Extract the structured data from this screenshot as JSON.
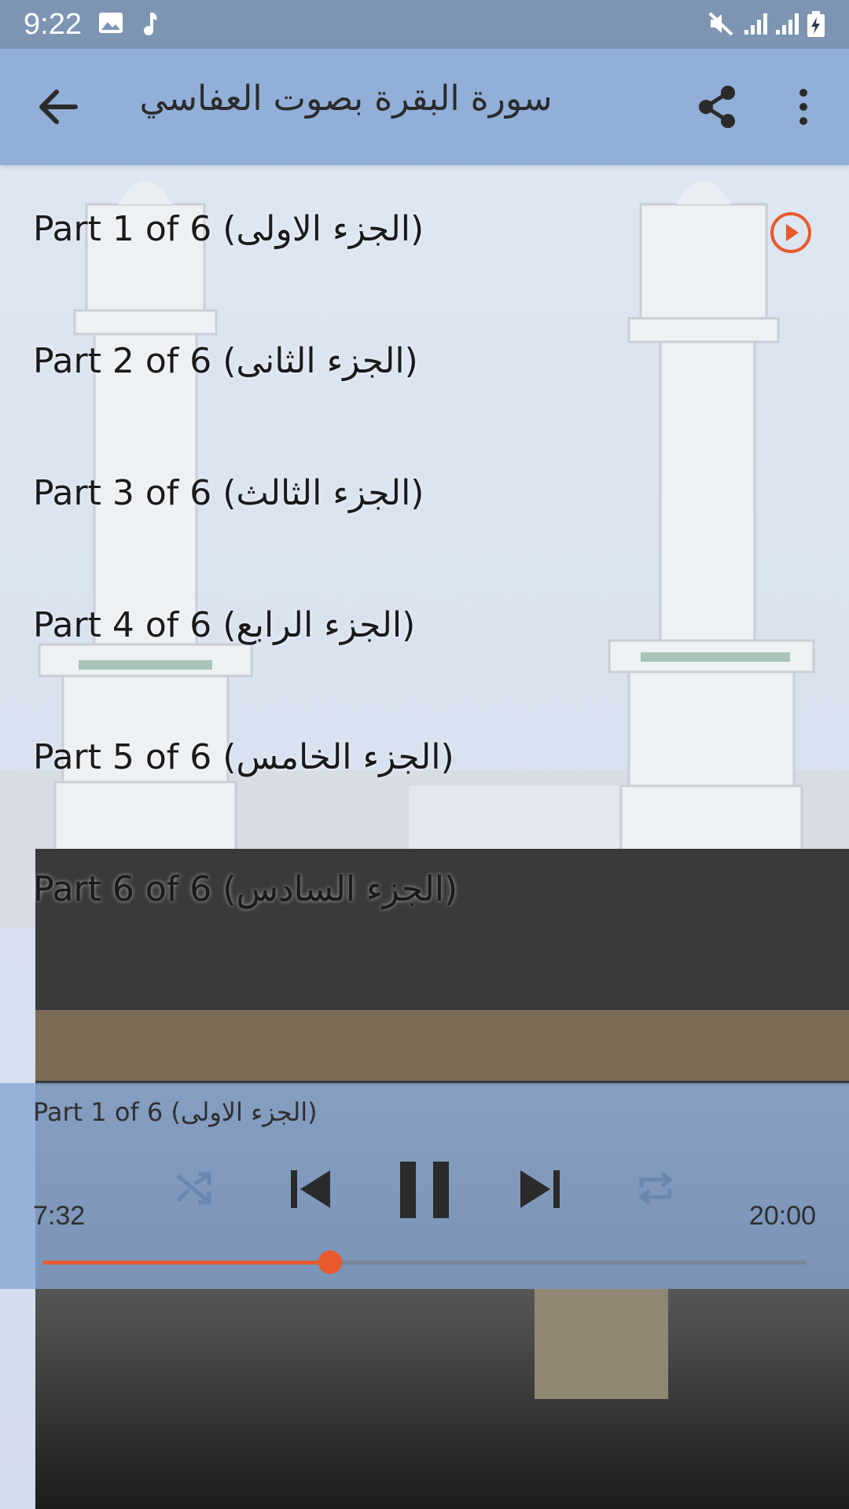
{
  "status_bar": {
    "time": "9:22",
    "icons": [
      "image-icon",
      "music-note-icon",
      "mute-icon",
      "signal-icon",
      "signal-icon",
      "battery-charging-icon"
    ]
  },
  "app_bar": {
    "title": "سورة البقرة بصوت العفاسي",
    "back_icon": "arrow-back-icon",
    "share_icon": "share-icon",
    "menu_icon": "more-vert-icon"
  },
  "tracks": [
    {
      "label": "Part 1 of 6 (الجزء الاولى)",
      "playing": true
    },
    {
      "label": "Part 2 of 6 (الجزء الثانى)",
      "playing": false
    },
    {
      "label": "Part 3 of 6 (الجزء الثالث)",
      "playing": false
    },
    {
      "label": "Part 4 of 6 (الجزء الرابع)",
      "playing": false
    },
    {
      "label": "Part 5 of 6 (الجزء الخامس)",
      "playing": false
    },
    {
      "label": "Part 6 of 6 (الجزء السادس)",
      "playing": false
    }
  ],
  "player": {
    "now_playing": "Part 1 of 6 (الجزء الاولى)",
    "elapsed": "7:32",
    "total": "20:00",
    "progress": 0.376,
    "controls": [
      "shuffle-icon",
      "skip-previous-icon",
      "pause-icon",
      "skip-next-icon",
      "repeat-icon"
    ]
  },
  "colors": {
    "accent": "#e85a2b",
    "app_bar": "#8aaad6",
    "status_bar": "#7d95b2"
  }
}
